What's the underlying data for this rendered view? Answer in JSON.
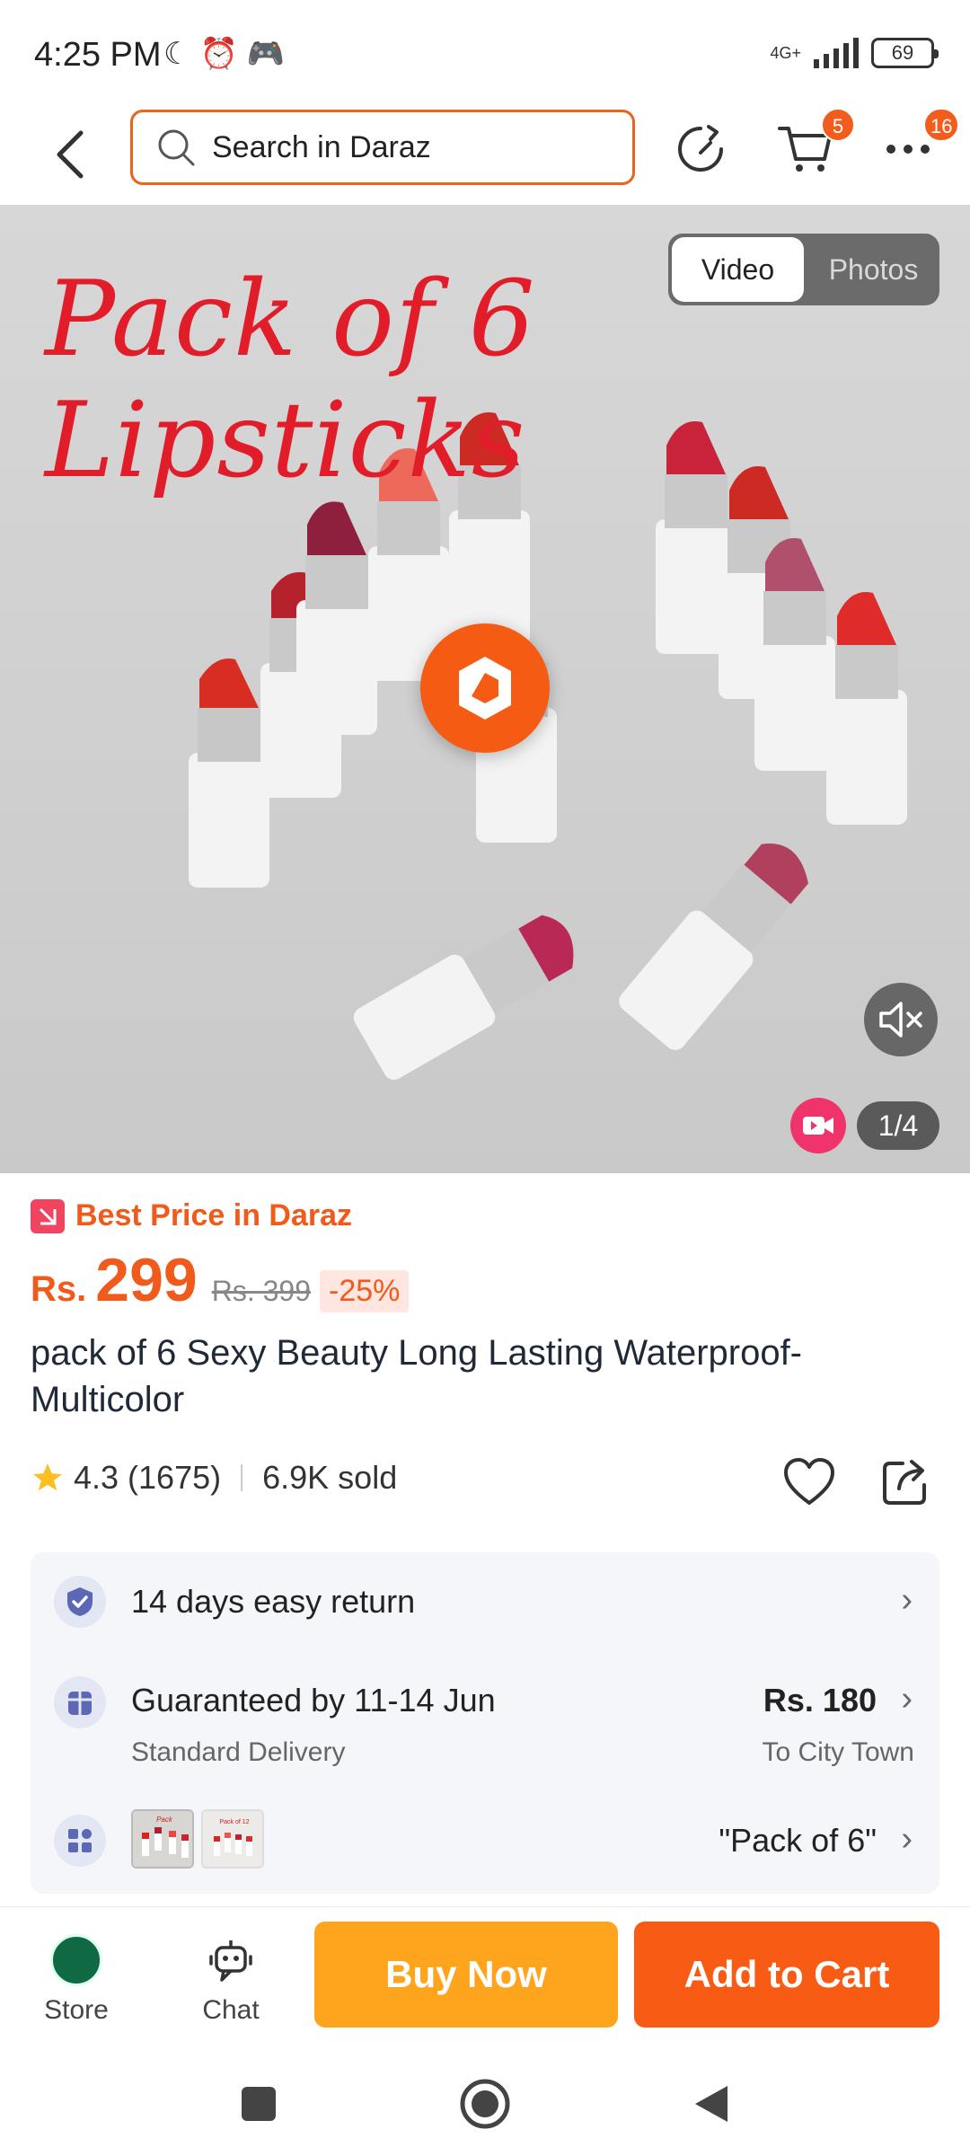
{
  "status_bar": {
    "time": "4:25 PM",
    "network": "4G+",
    "battery": "69"
  },
  "header": {
    "search_placeholder": "Search in Daraz",
    "cart_badge": "5",
    "more_badge": "16"
  },
  "hero": {
    "title": "Pack of 6 Lipsticks",
    "toggle_video": "Video",
    "toggle_photos": "Photos",
    "counter": "1/4"
  },
  "product": {
    "best_price_label": "Best Price in Daraz",
    "currency": "Rs.",
    "price": "299",
    "old_price": "Rs. 399",
    "discount": "-25%",
    "title": "pack of 6 Sexy Beauty Long Lasting Waterproof-Multicolor",
    "rating": "4.3",
    "reviews": "(1675)",
    "sold": "6.9K sold"
  },
  "info": {
    "return_label": "14 days easy return",
    "delivery_label": "Guaranteed by 11-14 Jun",
    "delivery_sub": "Standard Delivery",
    "delivery_price": "Rs. 180",
    "delivery_location": "To City Town",
    "variant_label": "\"Pack of 6\""
  },
  "bottom": {
    "store_label": "Store",
    "chat_label": "Chat",
    "buy_now": "Buy Now",
    "add_to_cart": "Add to Cart"
  },
  "colors": {
    "accent": "#f85b13",
    "buy_now": "#fea51d",
    "hero_title": "#e11d2a"
  }
}
